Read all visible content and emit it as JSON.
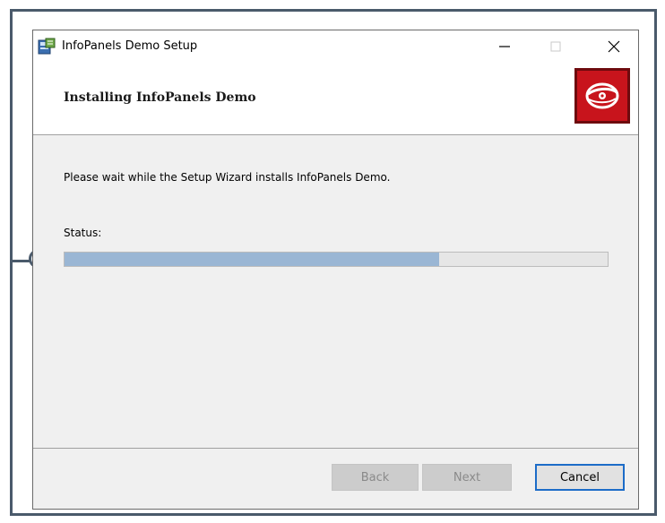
{
  "window": {
    "title": "InfoPanels Demo Setup",
    "minimize_glyph": "—",
    "maximize_glyph": "☐",
    "close_glyph": "✕"
  },
  "banner": {
    "title": "Installing InfoPanels Demo",
    "logo_icon": "disc-icon",
    "logo_color": "#c8141c"
  },
  "body": {
    "message": "Please wait while the Setup Wizard installs InfoPanels Demo.",
    "status_label": "Status:"
  },
  "progress": {
    "fraction": 0.69,
    "fill_color": "#9ab6d4"
  },
  "buttons": {
    "back": "Back",
    "next": "Next",
    "cancel": "Cancel"
  }
}
